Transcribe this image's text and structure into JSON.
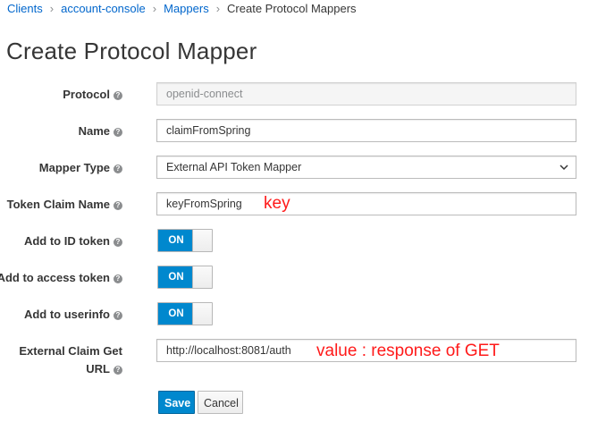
{
  "breadcrumb": {
    "items": [
      "Clients",
      "account-console",
      "Mappers"
    ],
    "current": "Create Protocol Mappers"
  },
  "page_title": "Create Protocol Mapper",
  "form": {
    "protocol": {
      "label": "Protocol",
      "value": "openid-connect"
    },
    "name": {
      "label": "Name",
      "value": "claimFromSpring"
    },
    "mapper_type": {
      "label": "Mapper Type",
      "value": "External API Token Mapper"
    },
    "token_claim_name": {
      "label": "Token Claim Name",
      "value": "keyFromSpring",
      "annotation": "key"
    },
    "add_to_id_token": {
      "label": "Add to ID token",
      "state": "ON"
    },
    "add_to_access_token": {
      "label": "Add to access token",
      "state": "ON"
    },
    "add_to_userinfo": {
      "label": "Add to userinfo",
      "state": "ON"
    },
    "external_claim_url": {
      "label_line1": "External Claim Get",
      "label_line2": "URL",
      "value": "http://localhost:8081/auth",
      "annotation": "value : response of GET"
    }
  },
  "buttons": {
    "save": "Save",
    "cancel": "Cancel"
  },
  "colors": {
    "primary": "#0088ce",
    "link": "#0066cc",
    "annotation": "#ff1a1a"
  }
}
